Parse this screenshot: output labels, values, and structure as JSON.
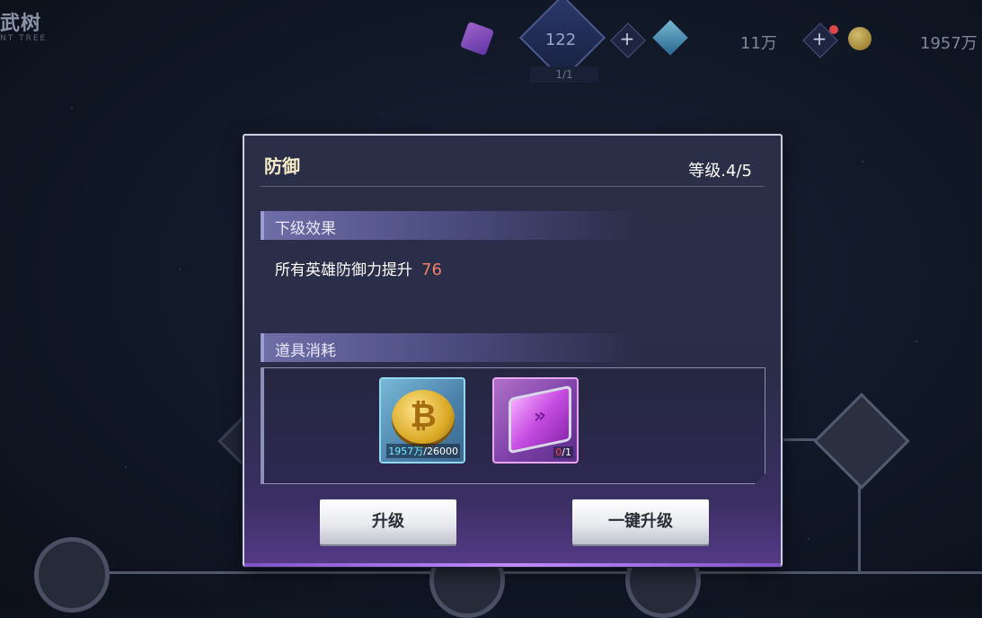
{
  "header": {
    "title": "武树",
    "subtitle": "NT TREE"
  },
  "topbar": {
    "level": "122",
    "level_progress": "1/1",
    "diamonds": "11万",
    "coins": "1957万"
  },
  "dialog": {
    "title": "防御",
    "level_text": "等级.4/5",
    "next_effect_heading": "下级效果",
    "effect_description": "所有英雄防御力提升",
    "effect_value": "76",
    "cost_heading": "道具消耗",
    "items": [
      {
        "icon": "gold-coin-icon",
        "have": "1957万",
        "need": "/26000"
      },
      {
        "icon": "purple-chip-icon",
        "have": "0",
        "need": "/1"
      }
    ],
    "buttons": {
      "upgrade": "升级",
      "one_click_upgrade": "一键升级"
    }
  },
  "colors": {
    "accent_effect": "#f08068",
    "dialog_bg": "#2a2f47",
    "button_bg": "#e9eaee"
  }
}
